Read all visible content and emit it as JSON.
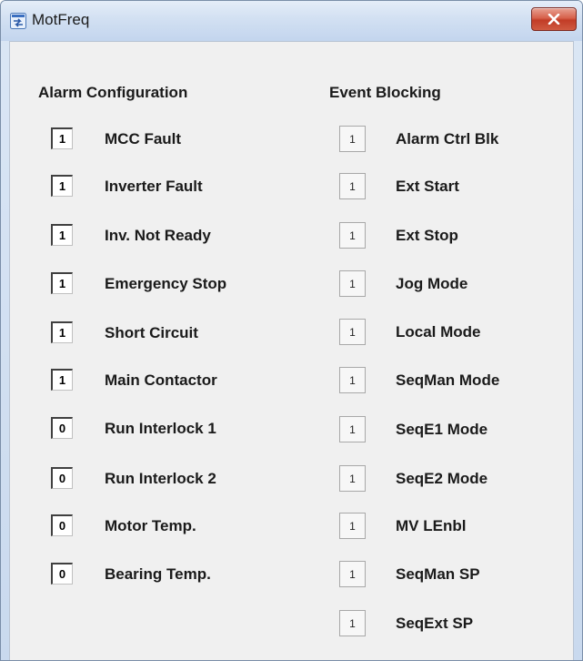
{
  "window": {
    "title": "MotFreq",
    "icon": "app-window-icon",
    "close_icon": "close-icon"
  },
  "alarm_configuration": {
    "title": "Alarm Configuration",
    "items": [
      {
        "value": "1",
        "label": "MCC Fault"
      },
      {
        "value": "1",
        "label": "Inverter Fault"
      },
      {
        "value": "1",
        "label": "Inv. Not Ready"
      },
      {
        "value": "1",
        "label": "Emergency Stop"
      },
      {
        "value": "1",
        "label": "Short Circuit"
      },
      {
        "value": "1",
        "label": "Main Contactor"
      },
      {
        "value": "0",
        "label": "Run Interlock 1"
      },
      {
        "value": "0",
        "label": "Run Interlock 2"
      },
      {
        "value": "0",
        "label": "Motor Temp."
      },
      {
        "value": "0",
        "label": "Bearing Temp."
      }
    ]
  },
  "event_blocking": {
    "title": "Event Blocking",
    "items": [
      {
        "value": "1",
        "label": "Alarm Ctrl Blk"
      },
      {
        "value": "1",
        "label": "Ext Start"
      },
      {
        "value": "1",
        "label": "Ext Stop"
      },
      {
        "value": "1",
        "label": "Jog Mode"
      },
      {
        "value": "1",
        "label": "Local Mode"
      },
      {
        "value": "1",
        "label": "SeqMan Mode"
      },
      {
        "value": "1",
        "label": "SeqE1 Mode"
      },
      {
        "value": "1",
        "label": "SeqE2 Mode"
      },
      {
        "value": "1",
        "label": "MV LEnbl"
      },
      {
        "value": "1",
        "label": "SeqMan SP"
      },
      {
        "value": "1",
        "label": "SeqExt SP"
      }
    ]
  }
}
